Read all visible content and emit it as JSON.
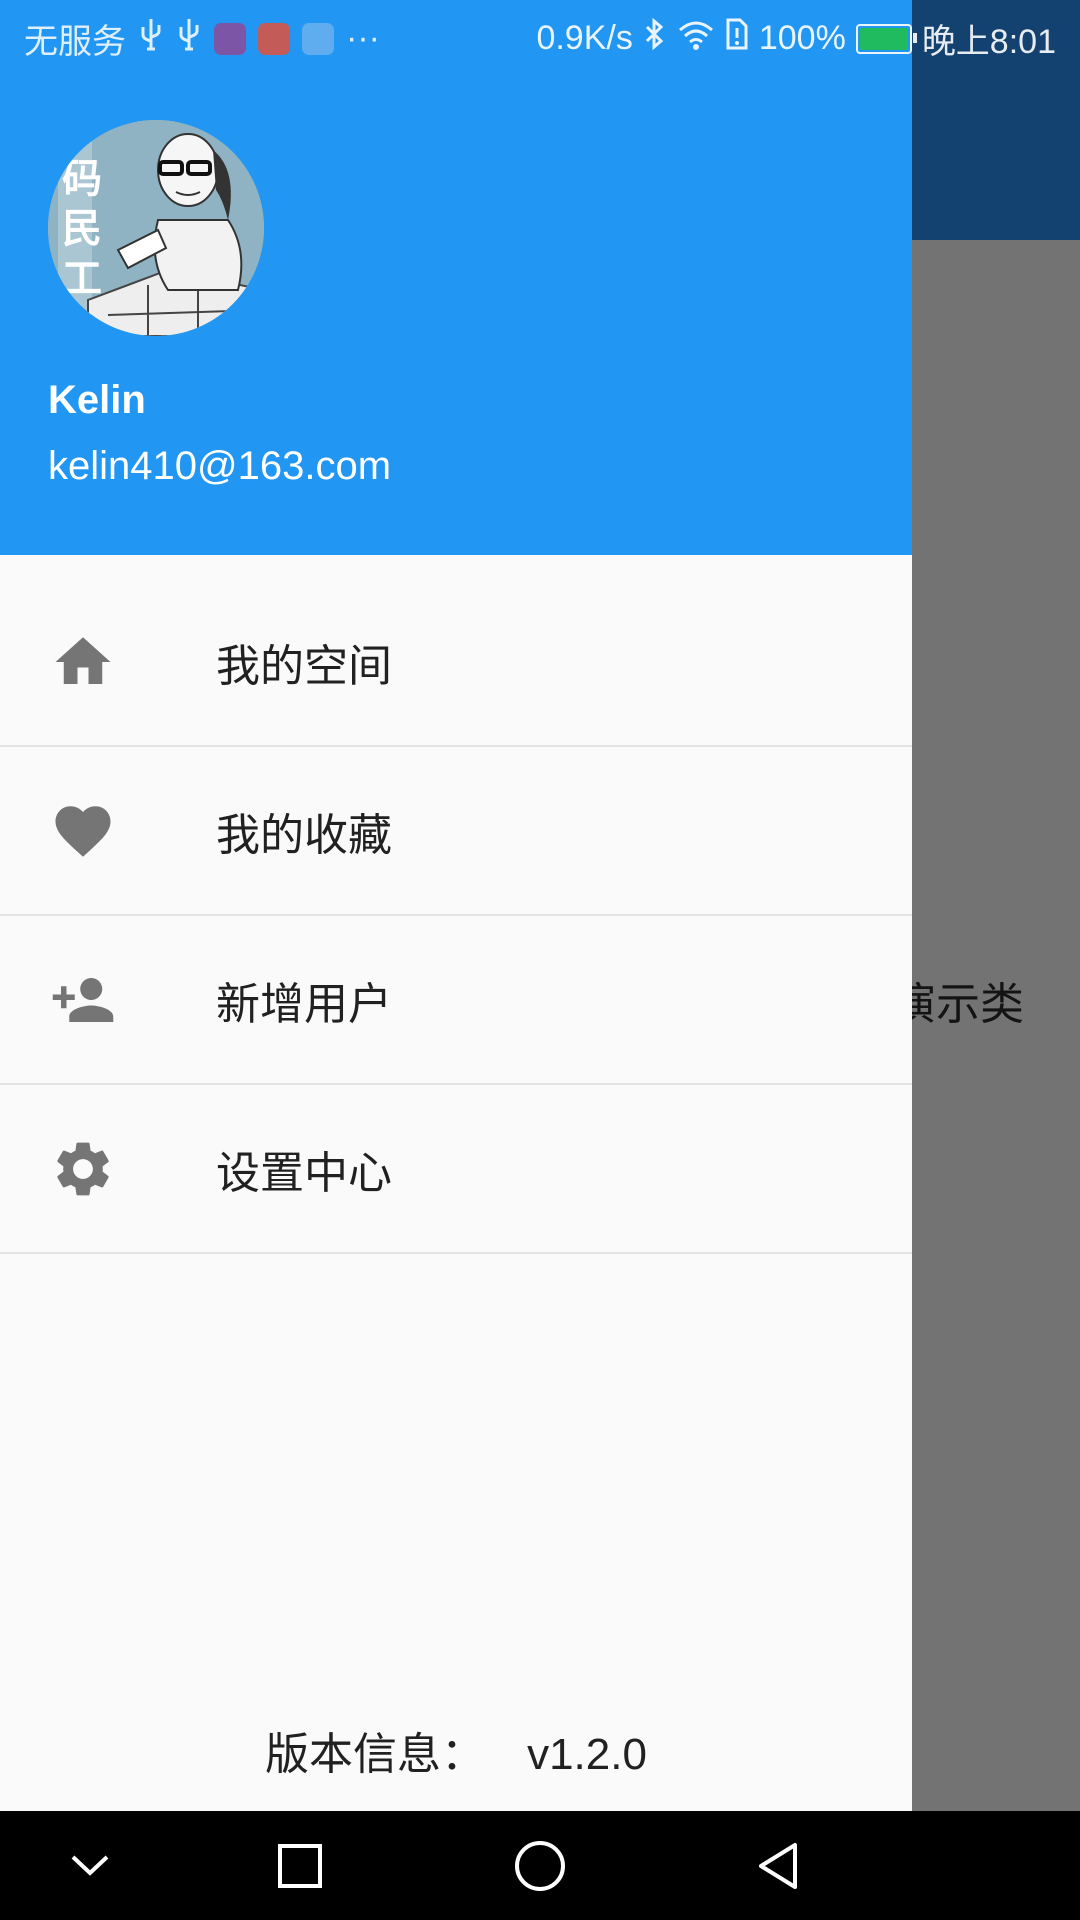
{
  "status_bar": {
    "carrier": "无服务",
    "more": "···",
    "net_speed": "0.9K/s",
    "battery": "100%",
    "time": "晚上8:01"
  },
  "background": {
    "partial_text": "演示类"
  },
  "drawer": {
    "user": {
      "name": "Kelin",
      "email": "kelin410@163.com",
      "avatar_text": "码民工"
    },
    "menu": [
      {
        "label": "我的空间",
        "icon": "home-icon"
      },
      {
        "label": "我的收藏",
        "icon": "heart-icon"
      },
      {
        "label": "新增用户",
        "icon": "person-add-icon"
      },
      {
        "label": "设置中心",
        "icon": "settings-icon"
      }
    ],
    "version": {
      "label": "版本信息：",
      "value": "v1.2.0"
    }
  },
  "colors": {
    "header": "#2196f3",
    "app_bar_dimmed": "#134170",
    "scrim": "#737373",
    "icon": "#757575"
  },
  "nav_bar": [
    "back-chevron-icon",
    "recents-icon",
    "home-circle-icon",
    "back-triangle-icon"
  ]
}
